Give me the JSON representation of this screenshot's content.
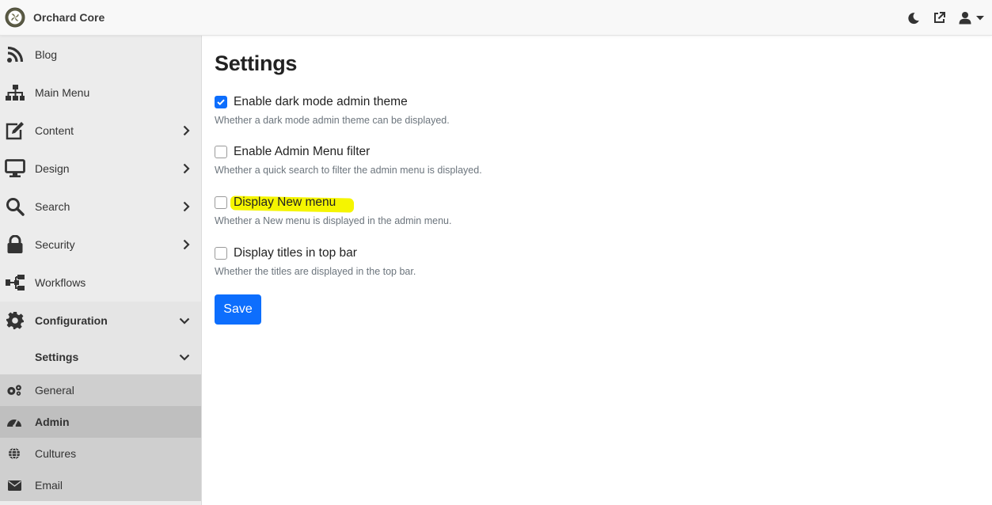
{
  "app": {
    "name": "Orchard Core"
  },
  "colors": {
    "accent": "#0d6efd",
    "highlight": "#f5f500",
    "sidebar_bg": "#ececec"
  },
  "topbar": {
    "actions": [
      {
        "icon": "moon-icon"
      },
      {
        "icon": "external-link-icon"
      },
      {
        "icon": "user-icon"
      }
    ]
  },
  "sidebar": {
    "items": [
      {
        "label": "Blog",
        "icon": "rss-icon"
      },
      {
        "label": "Main Menu",
        "icon": "sitemap-icon"
      },
      {
        "label": "Content",
        "icon": "edit-icon",
        "expandable": true
      },
      {
        "label": "Design",
        "icon": "desktop-icon",
        "expandable": true
      },
      {
        "label": "Search",
        "icon": "search-icon",
        "expandable": true
      },
      {
        "label": "Security",
        "icon": "lock-icon",
        "expandable": true
      },
      {
        "label": "Workflows",
        "icon": "workflows-icon"
      },
      {
        "label": "Configuration",
        "icon": "gear-icon",
        "expanded": true
      }
    ],
    "settings_group": {
      "label": "Settings"
    },
    "settings_items": [
      {
        "label": "General",
        "icon": "cogs-icon"
      },
      {
        "label": "Admin",
        "icon": "dashboard-icon",
        "active": true
      },
      {
        "label": "Cultures",
        "icon": "globe-icon"
      },
      {
        "label": "Email",
        "icon": "envelope-icon"
      }
    ]
  },
  "main": {
    "title": "Settings",
    "settings": [
      {
        "label": "Enable dark mode admin theme",
        "hint": "Whether a dark mode admin theme can be displayed.",
        "checked": true
      },
      {
        "label": "Enable Admin Menu filter",
        "hint": "Whether a quick search to filter the admin menu is displayed.",
        "checked": false
      },
      {
        "label": "Display New menu",
        "hint": "Whether a New menu is displayed in the admin menu.",
        "checked": false,
        "highlighted": true
      },
      {
        "label": "Display titles in top bar",
        "hint": "Whether the titles are displayed in the top bar.",
        "checked": false
      }
    ],
    "save_label": "Save"
  }
}
